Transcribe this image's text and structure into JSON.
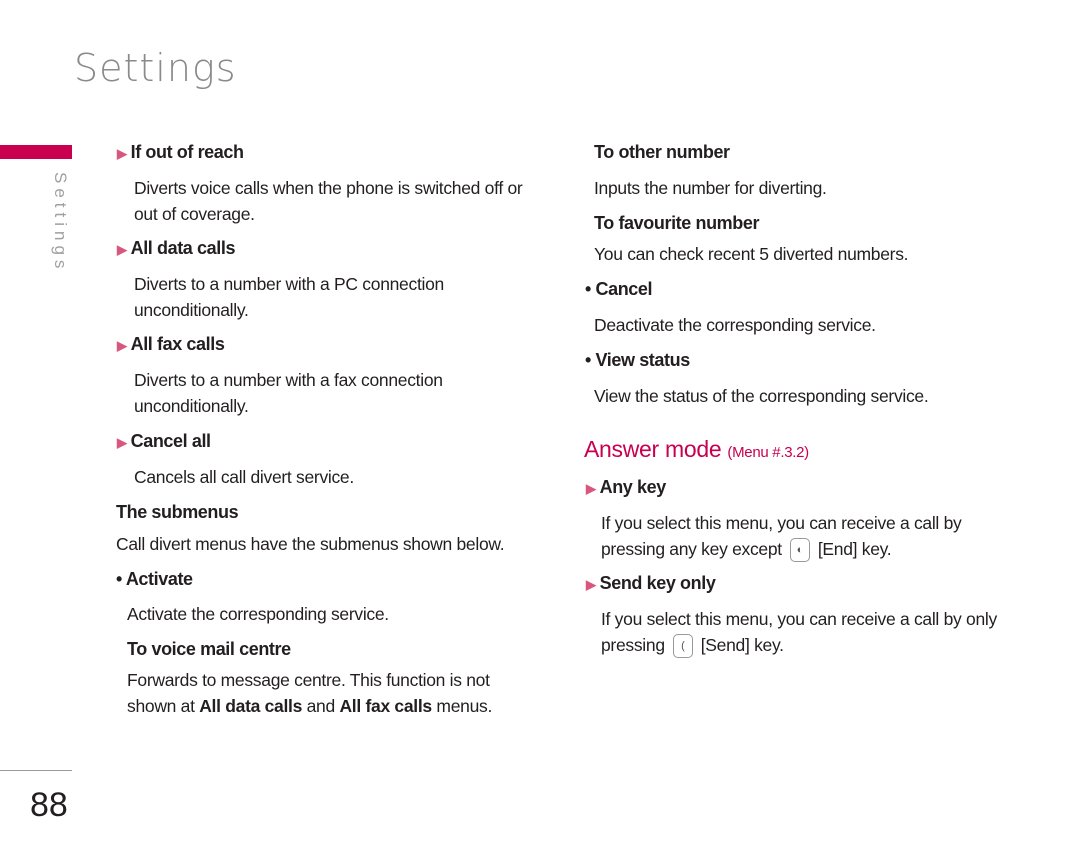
{
  "header": {
    "title": "Settings",
    "side_label": "Settings",
    "page_number": "88"
  },
  "left": {
    "if_out_of_reach": {
      "title": "If out of reach",
      "text1": "Diverts voice calls when the phone is switched off or",
      "text2": "out of coverage."
    },
    "all_data_calls": {
      "title": "All data calls",
      "text1": "Diverts to a number with a PC connection",
      "text2": "unconditionally."
    },
    "all_fax_calls": {
      "title": "All fax calls",
      "text1": "Diverts to a number with a fax connection",
      "text2": "unconditionally."
    },
    "cancel_all": {
      "title": "Cancel all",
      "text1": "Cancels all call divert service."
    },
    "submenus": {
      "title": "The submenus",
      "text1": "Call divert menus have the submenus shown below."
    },
    "activate": {
      "title": "• Activate",
      "text1": "Activate the corresponding service."
    },
    "voice_mail": {
      "title": "To voice mail centre",
      "text1": "Forwards to message centre. This function is not",
      "t2a": "shown at ",
      "t2b": "All data calls",
      "t2c": " and ",
      "t2d": "All fax calls",
      "t2e": " menus."
    }
  },
  "right": {
    "other_number": {
      "title": "To other number",
      "text1": "Inputs the number for diverting."
    },
    "favourite": {
      "title": "To favourite number",
      "text1": "You can check recent 5 diverted numbers."
    },
    "cancel": {
      "title": "• Cancel",
      "text1": "Deactivate the corresponding service."
    },
    "view_status": {
      "title": "• View status",
      "text1": "View the status of the corresponding service."
    },
    "answer_mode": {
      "title": "Answer mode",
      "menu": "(Menu #.3.2)"
    },
    "any_key": {
      "title": "Any key",
      "text1": "If you select this menu, you can receive a call by",
      "t2a": "pressing any key except",
      "t2b": "[End] key."
    },
    "send_key": {
      "title": "Send key only",
      "text1": "If you select this menu, you can receive a call by only",
      "t2a": "pressing",
      "t2b": "[Send] key."
    }
  },
  "colors": {
    "accent": "#c8004f",
    "bullet": "#d9577e"
  },
  "icons": {
    "bullet": "triangle-right",
    "end_key": "end-key-icon",
    "send_key": "send-key-icon"
  }
}
